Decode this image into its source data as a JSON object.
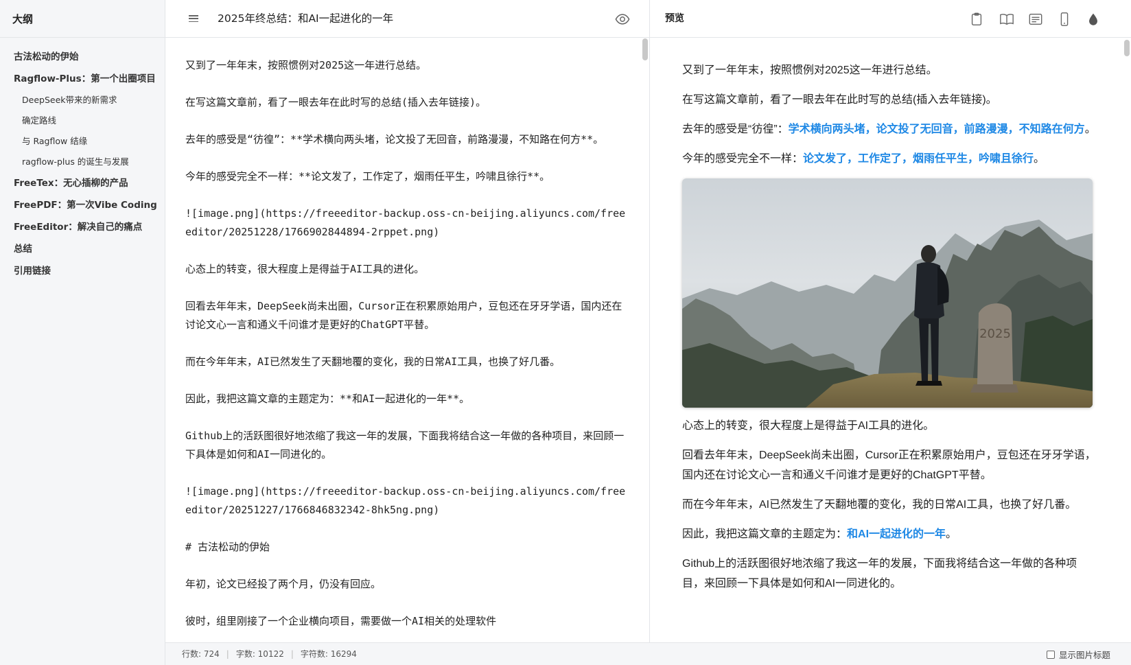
{
  "outline": {
    "title": "大纲",
    "items": [
      {
        "label": "古法松动的伊始",
        "level": 1
      },
      {
        "label": "Ragflow-Plus：第一个出圈项目",
        "level": 1
      },
      {
        "label": "DeepSeek带来的新需求",
        "level": 2
      },
      {
        "label": "确定路线",
        "level": 2
      },
      {
        "label": "与 Ragflow 结缘",
        "level": 2
      },
      {
        "label": "ragflow-plus 的诞生与发展",
        "level": 2
      },
      {
        "label": "FreeTex：无心插柳的产品",
        "level": 1
      },
      {
        "label": "FreePDF：第一次Vibe Coding",
        "level": 1
      },
      {
        "label": "FreeEditor：解决自己的痛点",
        "level": 1
      },
      {
        "label": "总结",
        "level": 1
      },
      {
        "label": "引用链接",
        "level": 1
      }
    ]
  },
  "editor": {
    "title": "2025年终总结：和AI一起进化的一年",
    "lines": [
      "又到了一年年末，按照惯例对2025这一年进行总结。",
      "在写这篇文章前，看了一眼去年在此时写的总结(插入去年链接)。",
      "去年的感受是“彷徨”：**学术横向两头堵，论文投了无回音，前路漫漫，不知路在何方**。",
      "今年的感受完全不一样：**论文发了，工作定了，烟雨任平生，吟啸且徐行**。",
      "![image.png](https://freeeditor-backup.oss-cn-beijing.aliyuncs.com/freeeditor/20251228/1766902844894-2rppet.png)",
      "心态上的转变，很大程度上是得益于AI工具的进化。",
      "回看去年年末，DeepSeek尚未出圈，Cursor正在积累原始用户，豆包还在牙牙学语，国内还在讨论文心一言和通义千问谁才是更好的ChatGPT平替。",
      "而在今年年末，AI已然发生了天翻地覆的变化，我的日常AI工具，也换了好几番。",
      "因此，我把这篇文章的主题定为：**和AI一起进化的一年**。",
      "Github上的活跃图很好地浓缩了我这一年的发展，下面我将结合这一年做的各种项目，来回顾一下具体是如何和AI一同进化的。",
      "![image.png](https://freeeditor-backup.oss-cn-beijing.aliyuncs.com/freeeditor/20251227/1766846832342-8hk5ng.png)",
      "# 古法松动的伊始",
      "年初，论文已经投了两个月，仍没有回应。",
      "彼时，组里刚接了一个企业横向项目，需要做一个AI相关的处理软件"
    ]
  },
  "preview": {
    "title": "预览",
    "paragraphs": [
      {
        "plain": "又到了一年年末，按照惯例对2025这一年进行总结。",
        "bold": "",
        "tail": ""
      },
      {
        "plain": "在写这篇文章前，看了一眼去年在此时写的总结(插入去年链接)。",
        "bold": "",
        "tail": ""
      },
      {
        "plain": "去年的感受是“彷徨”：",
        "bold": "学术横向两头堵，论文投了无回音，前路漫漫，不知路在何方",
        "tail": "。"
      },
      {
        "plain": "今年的感受完全不一样：",
        "bold": "论文发了，工作定了，烟雨任平生，吟啸且徐行",
        "tail": "。"
      }
    ],
    "paragraphs_after_image": [
      {
        "plain": "心态上的转变，很大程度上是得益于AI工具的进化。",
        "bold": "",
        "tail": ""
      },
      {
        "plain": "回看去年年末，DeepSeek尚未出圈，Cursor正在积累原始用户，豆包还在牙牙学语，国内还在讨论文心一言和通义千问谁才是更好的ChatGPT平替。",
        "bold": "",
        "tail": ""
      },
      {
        "plain": "而在今年年末，AI已然发生了天翻地覆的变化，我的日常AI工具，也换了好几番。",
        "bold": "",
        "tail": ""
      },
      {
        "plain": "因此，我把这篇文章的主题定为：",
        "bold": "和AI一起进化的一年",
        "tail": "。"
      },
      {
        "plain": "Github上的活跃图很好地浓缩了我这一年的发展，下面我将结合这一年做的各种项目，来回顾一下具体是如何和AI一同进化的。",
        "bold": "",
        "tail": ""
      }
    ],
    "image_stone_text": "2025",
    "toolbar_icons": [
      "clipboard-icon",
      "book-icon",
      "article-icon",
      "mobile-icon",
      "theme-drop-icon"
    ]
  },
  "status": {
    "lines": "行数: 724",
    "words": "字数: 10122",
    "chars": "字符数: 16294",
    "caption_toggle": "显示图片标题",
    "caption_checked": false
  },
  "colors": {
    "accent": "#1e88e5",
    "sidebar_bg": "#f5f6f8",
    "border": "#e3e5e8"
  }
}
